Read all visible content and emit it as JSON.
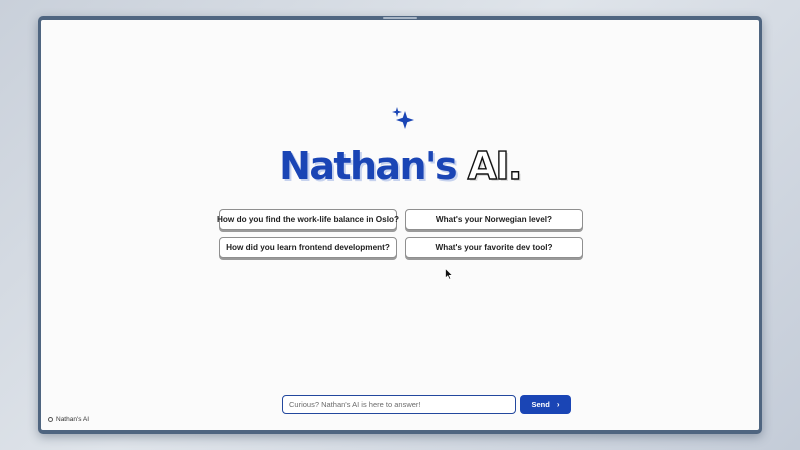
{
  "app": {
    "brand_name": "Nathan's",
    "brand_suffix": "AI.",
    "accent_color": "#1a45b5",
    "sparkle_icon": "sparkles-icon"
  },
  "suggestions": [
    "How do you find the work-life balance in Oslo?",
    "What's your Norwegian level?",
    "How did you learn frontend development?",
    "What's your favorite dev tool?"
  ],
  "composer": {
    "placeholder": "Curious? Nathan's AI is here to answer!",
    "value": "",
    "send_label": "Send",
    "send_icon": "chevron-right-icon"
  },
  "footer": {
    "label": "Nathan's AI"
  }
}
